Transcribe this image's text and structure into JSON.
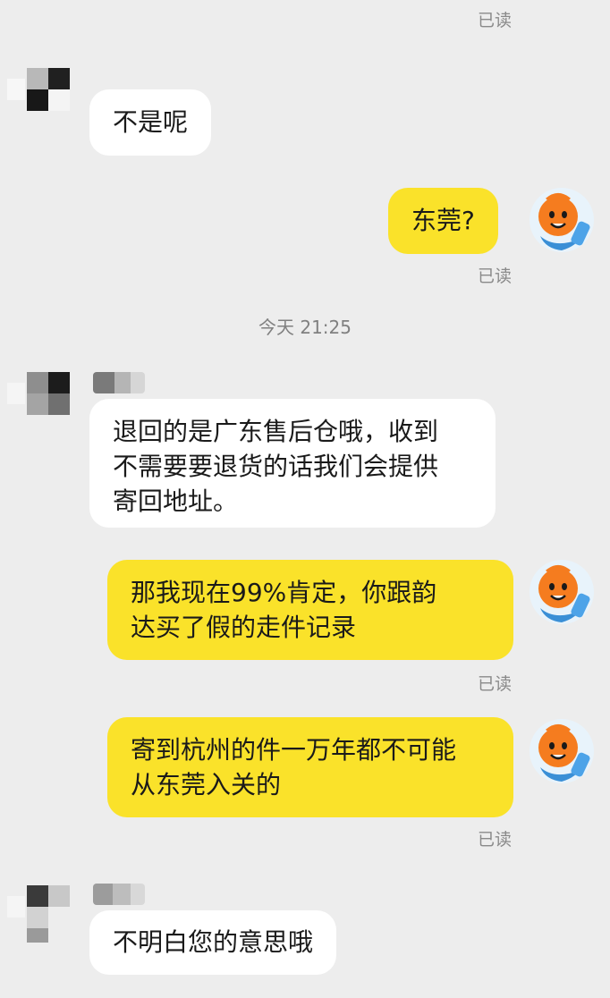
{
  "conversation": {
    "timestamp_label": "今天 21:25",
    "read_receipt": "已读",
    "messages": [
      {
        "from": "me",
        "text": ""
      },
      {
        "from": "them",
        "text": "不是呢"
      },
      {
        "from": "me",
        "text": "东莞?"
      },
      {
        "from": "them",
        "text": "退回的是广东售后仓哦，收到\n不需要要退货的话我们会提供\n寄回地址。"
      },
      {
        "from": "me",
        "text": "那我现在99%肯定，你跟韵\n达买了假的走件记录"
      },
      {
        "from": "me",
        "text": "寄到杭州的件一万年都不可能\n从东莞入关的"
      },
      {
        "from": "them",
        "text": "不明白您的意思哦"
      }
    ]
  },
  "colors": {
    "background": "#ededed",
    "incoming_bubble": "#ffffff",
    "outgoing_bubble": "#fae22a",
    "receipt_text": "#8a8a8a"
  },
  "icons": {
    "my_avatar": "orange-cartoon-face-avatar-icon",
    "contact_avatar": "pixelated-contact-avatar-icon"
  }
}
